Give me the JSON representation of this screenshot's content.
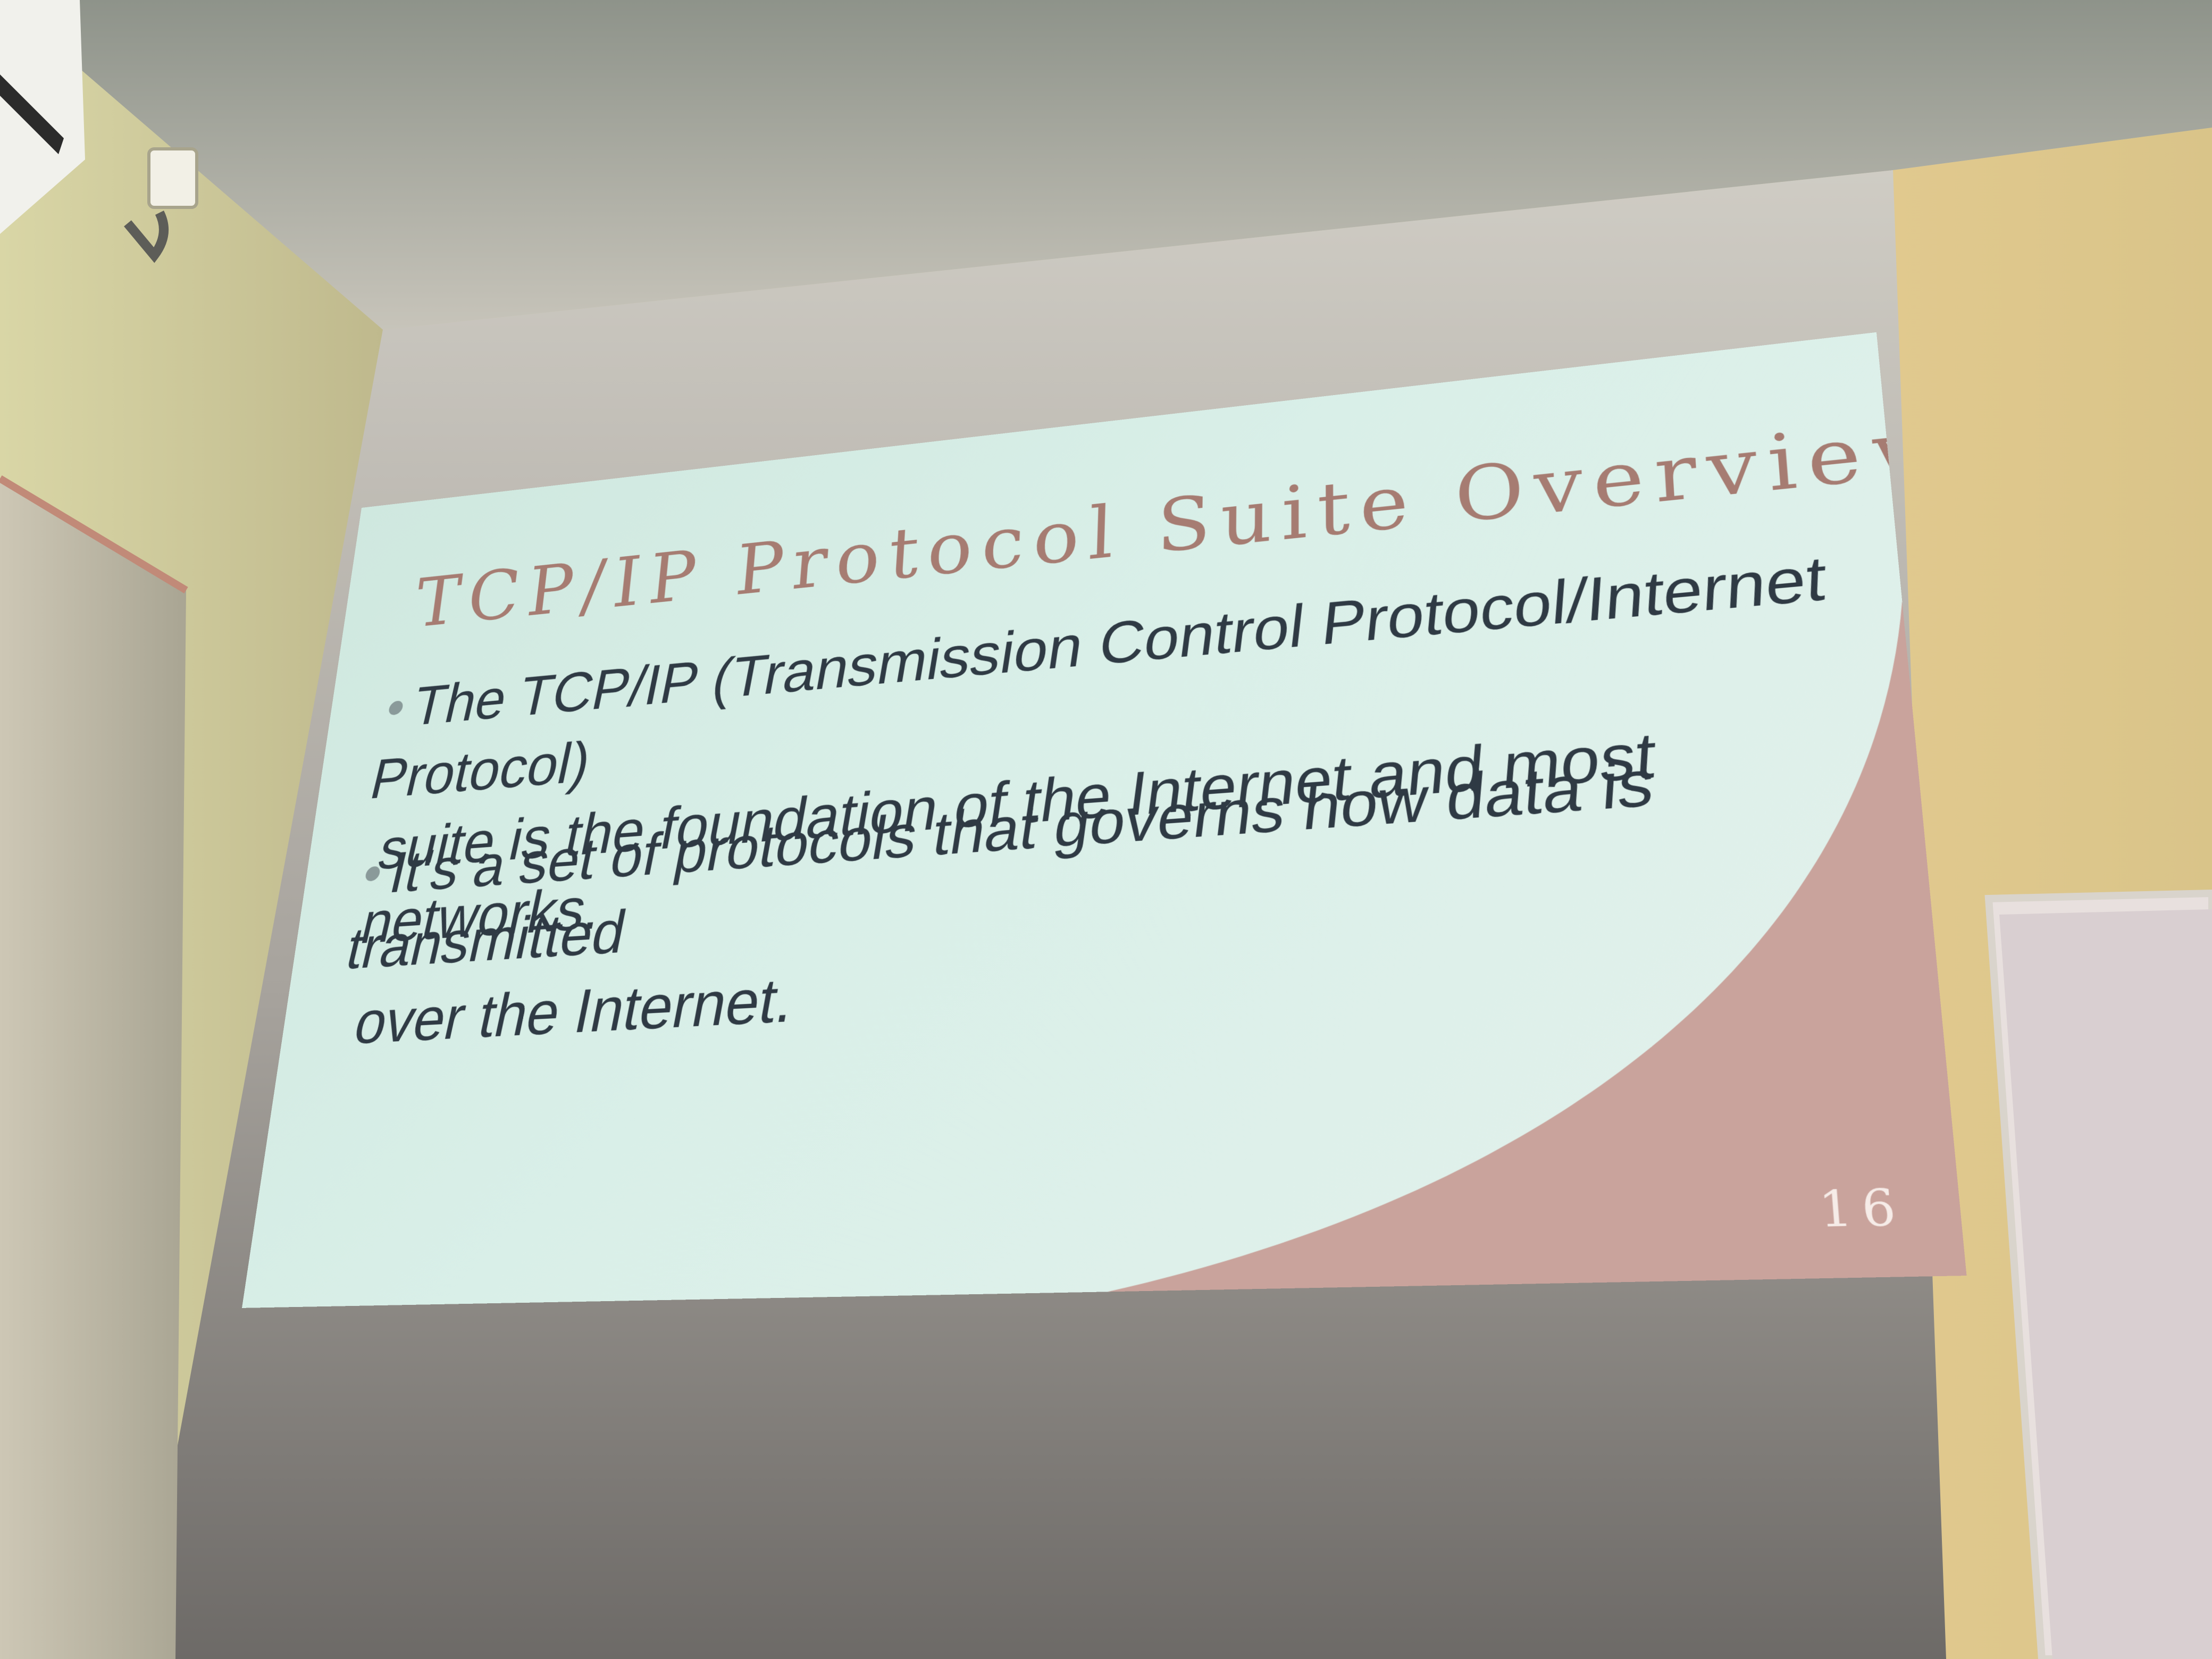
{
  "slide": {
    "title": "TCP/IP Protocol Suite Overview",
    "bullets": [
      {
        "line1": "The TCP/IP (Transmission Control Protocol/Internet Protocol)",
        "line2": "suite is the foundation of the Internet and most networks."
      },
      {
        "line1": "It's a set of protocols that governs how data is transmitted",
        "line2": "over the Internet."
      }
    ],
    "page_number": "16"
  },
  "colors": {
    "slide_background": "#d9efe8",
    "title": "#a67c72",
    "body_text": "#2f3a44",
    "accent_wave": "#c9a39c",
    "wall": "#e8e2b4",
    "screen": "#8c8986"
  }
}
